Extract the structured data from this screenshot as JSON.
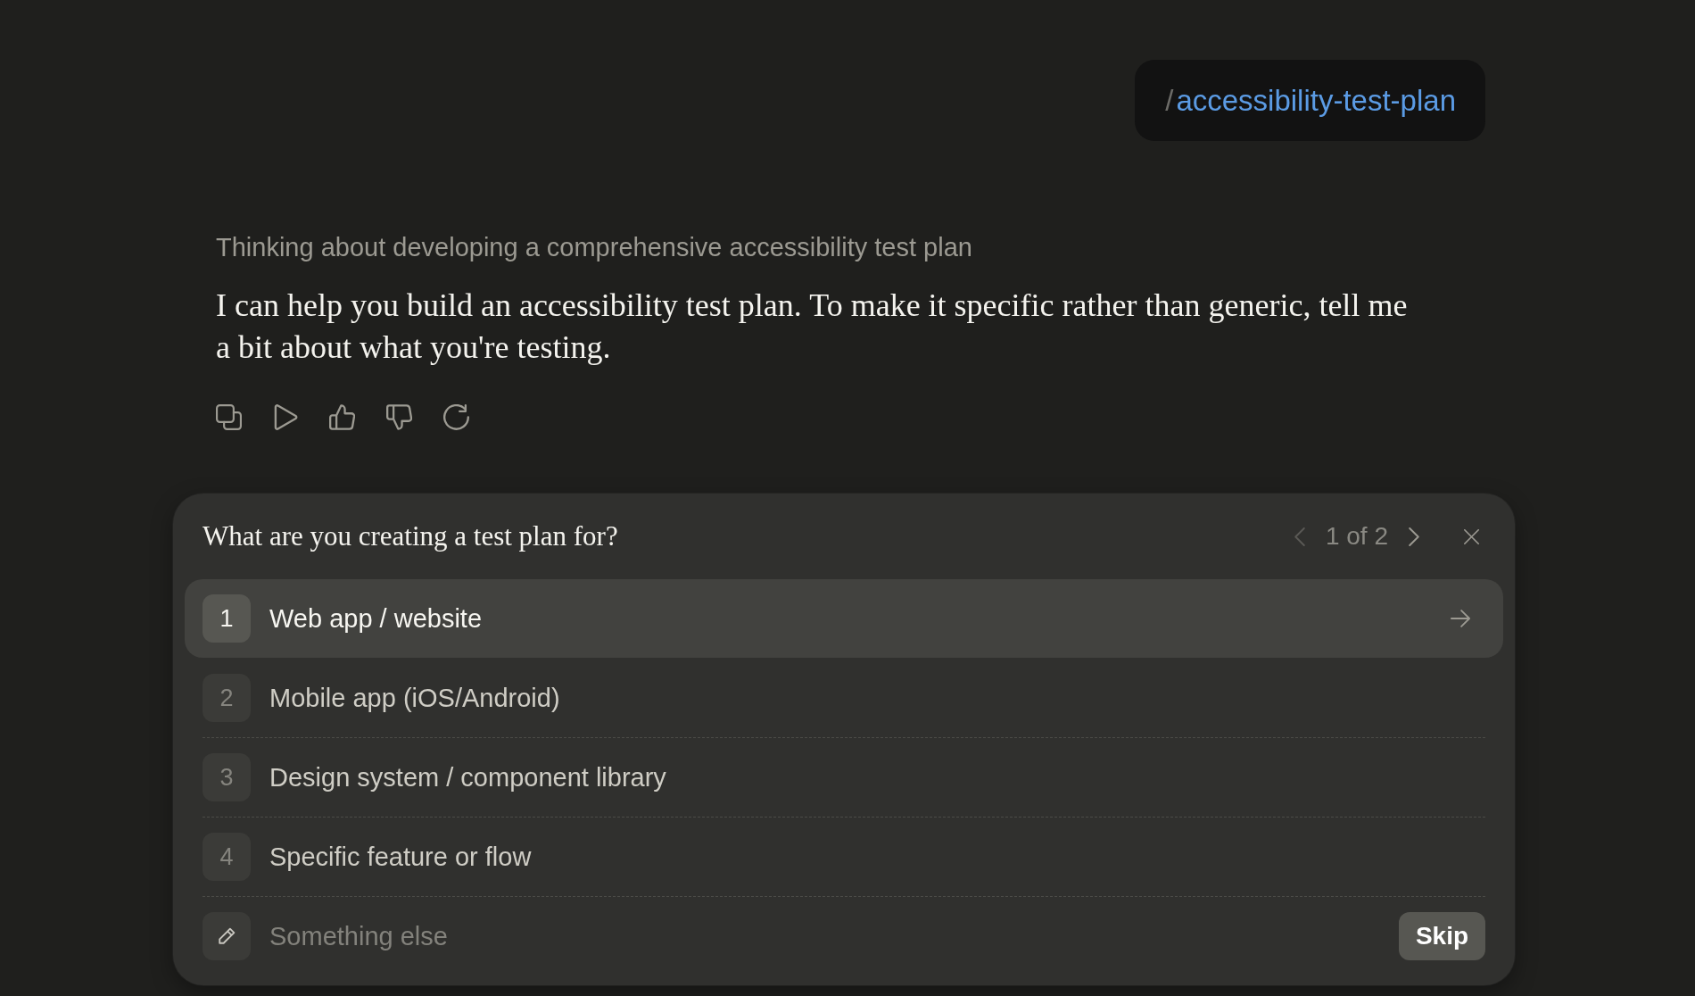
{
  "user_message": {
    "command": {
      "prefix": "/",
      "name": "accessibility-test-plan"
    }
  },
  "assistant_message": {
    "thinking": "Thinking about developing a comprehensive accessibility test plan",
    "text": "I can help you build an accessibility test plan. To make it specific rather than generic, tell me a bit about what you're testing."
  },
  "question": {
    "title": "What are you creating a test plan for?",
    "pager": {
      "label": "1 of 2",
      "previous": {
        "disabled": true
      },
      "next": {
        "disabled": false
      }
    },
    "options": [
      {
        "number": "1",
        "label": "Web app / website",
        "selected": true
      },
      {
        "number": "2",
        "label": "Mobile app (iOS/Android)",
        "selected": false
      },
      {
        "number": "3",
        "label": "Design system / component library",
        "selected": false
      },
      {
        "number": "4",
        "label": "Specific feature or flow",
        "selected": false
      }
    ],
    "other": {
      "placeholder": "Something else"
    },
    "skip_button": "Skip"
  }
}
